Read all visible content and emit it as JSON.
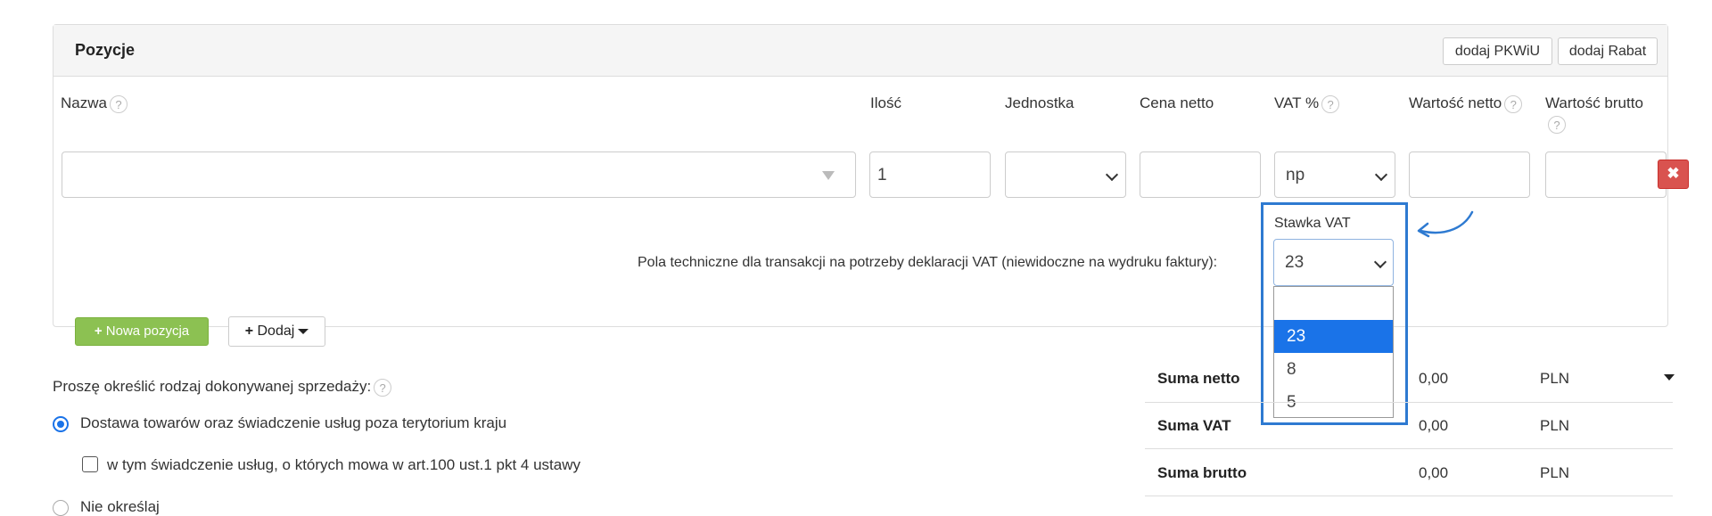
{
  "panel": {
    "title": "Pozycje",
    "buttons": {
      "pkwiu": "dodaj PKWiU",
      "rabat": "dodaj Rabat"
    }
  },
  "columns": {
    "nazwa": "Nazwa",
    "ilosc": "Ilość",
    "jednostka": "Jednostka",
    "cena_netto": "Cena netto",
    "vat": "VAT %",
    "wartosc_netto": "Wartość netto",
    "wartosc_brutto": "Wartość brutto",
    "help_mark": "?"
  },
  "row": {
    "nazwa_value": "",
    "ilosc_value": "1",
    "jednostka_value": "",
    "cena_netto_value": "",
    "vat_value": "np",
    "wartosc_netto_value": "",
    "wartosc_brutto_value": "",
    "delete_glyph": "✖"
  },
  "technical": {
    "text": "Pola techniczne dla transakcji na potrzeby deklaracji VAT (niewidoczne na wydruku faktury):",
    "stawka_label": "Stawka VAT",
    "stawka_value": "23",
    "options": [
      "",
      "23",
      "8",
      "5"
    ],
    "selected_option": "23"
  },
  "actions": {
    "nowa_pozycja": "Nowa pozycja",
    "dodaj": "Dodaj"
  },
  "sale_type": {
    "question": "Proszę określić rodzaj dokonywanej sprzedaży:",
    "options": {
      "dostawa": "Dostawa towarów oraz świadczenie usług poza terytorium kraju",
      "w_tym": "w tym świadczenie usług, o których mowa w art.100 ust.1 pkt 4 ustawy",
      "nie_okreslaj": "Nie określaj"
    },
    "selected": "dostawa"
  },
  "summary": {
    "rows": [
      {
        "label": "Suma netto",
        "value": "0,00",
        "currency": "PLN"
      },
      {
        "label": "Suma VAT",
        "value": "0,00",
        "currency": "PLN"
      },
      {
        "label": "Suma brutto",
        "value": "0,00",
        "currency": "PLN"
      }
    ]
  },
  "colors": {
    "highlight": "#2e7ad1",
    "selected_option": "#1a73e8",
    "green_button": "#8cc152",
    "delete_button": "#d9534f"
  }
}
